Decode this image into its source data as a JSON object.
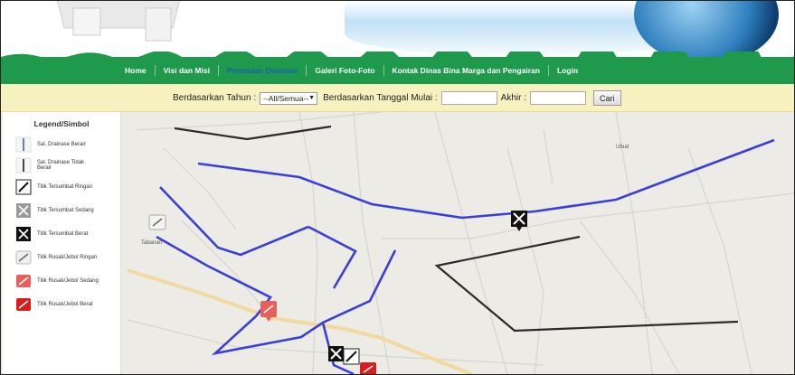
{
  "nav": {
    "items": [
      {
        "label": "Home",
        "active": false
      },
      {
        "label": "Visi dan Misi",
        "active": false
      },
      {
        "label": "Pemetaan Drainase",
        "active": true
      },
      {
        "label": "Galeri Foto-Foto",
        "active": false
      },
      {
        "label": "Kontak Dinas Bina Marga dan Pengairan",
        "active": false
      },
      {
        "label": "Login",
        "active": false
      }
    ]
  },
  "filter": {
    "year_label": "Berdasarkan Tahun :",
    "year_value": "--All/Semua--",
    "start_label": "Berdasarkan Tanggal Mulai :",
    "end_label": "Akhir :",
    "search_button": "Cari"
  },
  "legend": {
    "title": "Legend/Simbol",
    "items": [
      {
        "label": "Sal. Drainase Berair",
        "icon": "blue-line-icon"
      },
      {
        "label": "Sal. Drainase Tidak Berair",
        "icon": "black-line-icon"
      },
      {
        "label": "Titik Tersumbat Ringan",
        "icon": "blockage-light-icon"
      },
      {
        "label": "Titik Tersumbat Sedang",
        "icon": "blockage-medium-icon"
      },
      {
        "label": "Titik Tersumbat Berat",
        "icon": "blockage-heavy-icon"
      },
      {
        "label": "Titik Rusak/Jebol Ringan",
        "icon": "damage-light-icon"
      },
      {
        "label": "Titik Rusak/Jebol Sedang",
        "icon": "damage-medium-icon"
      },
      {
        "label": "Titik Rusak/Jebol Berat",
        "icon": "damage-heavy-icon"
      }
    ]
  },
  "map": {
    "place_labels": [
      "Ubud",
      "Tabanan"
    ],
    "colors": {
      "drain_water": "#3a3fd6",
      "drain_dry": "#2a2a2a",
      "nav_green": "#1f9a4c",
      "filter_bg": "#f6f1bf"
    }
  }
}
